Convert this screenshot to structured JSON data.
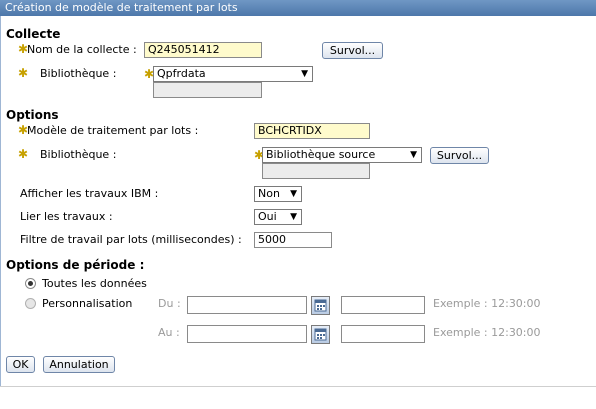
{
  "window": {
    "title": "Création de modèle de traitement par lots"
  },
  "collecte": {
    "heading": "Collecte",
    "nom_label": "Nom de la collecte :",
    "nom_value": "Q245051412",
    "browse_label": "Survol...",
    "bib_label": "Bibliothèque :",
    "bib_value": "Qpfrdata"
  },
  "options": {
    "heading": "Options",
    "modele_label": "Modèle de traitement par lots :",
    "modele_value": "BCHCRTIDX",
    "bib_label": "Bibliothèque :",
    "bib_value": "Bibliothèque source",
    "browse_label": "Survol...",
    "ibm_label": "Afficher les travaux IBM :",
    "ibm_value": "Non",
    "lier_label": "Lier les travaux :",
    "lier_value": "Oui",
    "filtre_label": "Filtre de travail par lots (millisecondes) :",
    "filtre_value": "5000"
  },
  "periode": {
    "heading": "Options de période :",
    "all_label": "Toutes les données",
    "custom_label": "Personnalisation",
    "du_label": "Du :",
    "au_label": "Au :",
    "example": "Exemple : 12:30:00"
  },
  "footer": {
    "ok_label": "OK",
    "cancel_label": "Annulation"
  },
  "icons": {
    "required": "asterisk-icon",
    "dropdown": "triangle-down",
    "calendar": "calendar-icon"
  },
  "colors": {
    "titlebar": "#5a82b4",
    "required_field": "#fffbcc",
    "required_star": "#c7a100"
  }
}
